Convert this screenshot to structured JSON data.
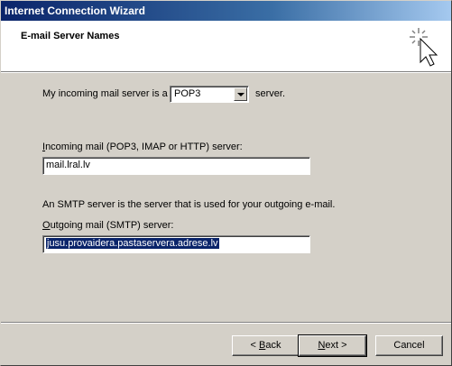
{
  "window": {
    "title": "Internet Connection Wizard"
  },
  "header": {
    "title": "E-mail Server Names",
    "icon": "wizard-wand-cursor-icon"
  },
  "incoming_server_type": {
    "label": "My incoming mail server is a",
    "selected": "POP3",
    "suffix": "server."
  },
  "incoming": {
    "label_accel": "I",
    "label_rest": "ncoming mail (POP3, IMAP or HTTP) server:",
    "value": "mail.lral.lv"
  },
  "smtp": {
    "description": "An SMTP server is the server that is used for your outgoing e-mail.",
    "label_accel": "O",
    "label_rest": "utgoing mail (SMTP) server:",
    "value": "jusu.provaidera.pastaservera.adrese.lv"
  },
  "buttons": {
    "back_prefix": "< ",
    "back_accel": "B",
    "back_rest": "ack",
    "next_accel": "N",
    "next_rest": "ext >",
    "cancel": "Cancel"
  }
}
